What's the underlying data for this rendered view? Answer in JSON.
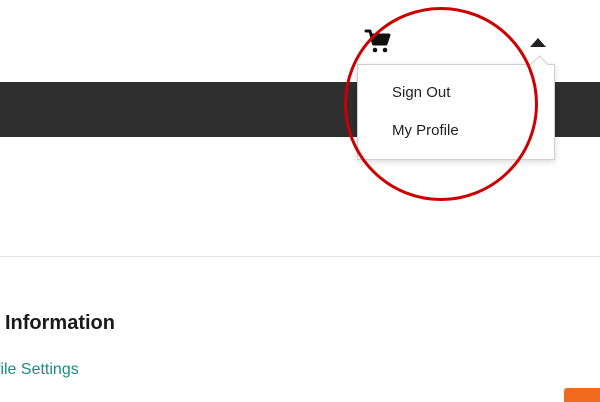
{
  "header": {
    "cart_icon": "shopping-cart-icon",
    "menu_toggle_icon": "caret-up-icon"
  },
  "account_menu": {
    "items": [
      {
        "label": "Sign Out"
      },
      {
        "label": "My Profile"
      }
    ]
  },
  "annotation": {
    "color": "#cc0000"
  },
  "section": {
    "heading": "Information",
    "link_label": "file Settings"
  },
  "colors": {
    "dark_band": "#2f2f2f",
    "link": "#1b8c84",
    "accent_button": "#f26a1b"
  }
}
